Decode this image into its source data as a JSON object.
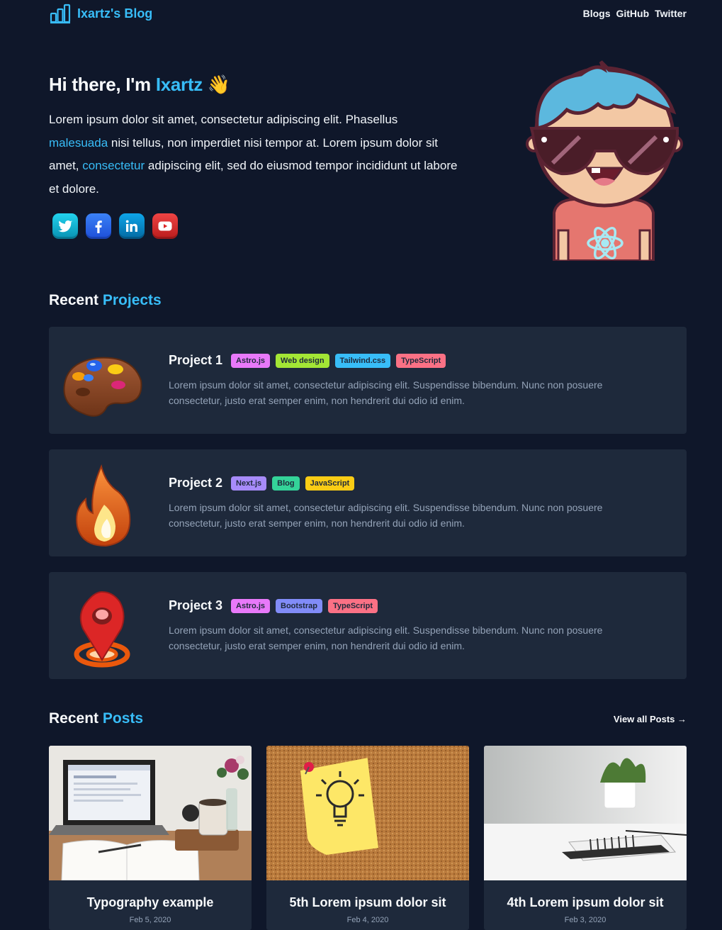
{
  "nav": {
    "brand": "Ixartz's Blog",
    "links": [
      "Blogs",
      "GitHub",
      "Twitter"
    ]
  },
  "hero": {
    "greeting": "Hi there, I'm ",
    "name": "Ixartz",
    "wave": "👋",
    "text_1": "Lorem ipsum dolor sit amet, consectetur adipiscing elit. Phasellus ",
    "link_1": "malesuada",
    "text_2": " nisi tellus, non imperdiet nisi tempor at. Lorem ipsum dolor sit amet, ",
    "link_2": "consectetur",
    "text_3": " adipiscing elit, sed do eiusmod tempor incididunt ut labore et dolore.",
    "socials": [
      "twitter-icon",
      "facebook-icon",
      "linkedin-icon",
      "youtube-icon"
    ]
  },
  "projects_section": {
    "title": "Recent ",
    "accent": "Projects"
  },
  "projects": [
    {
      "title": "Project 1",
      "icon": "palette-icon",
      "tags": [
        {
          "label": "Astro.js",
          "color": "#e879f9"
        },
        {
          "label": "Web design",
          "color": "#a3e635"
        },
        {
          "label": "Tailwind.css",
          "color": "#38bdf8"
        },
        {
          "label": "TypeScript",
          "color": "#fb7185"
        }
      ],
      "description": "Lorem ipsum dolor sit amet, consectetur adipiscing elit. Suspendisse bibendum. Nunc non posuere consectetur, justo erat semper enim, non hendrerit dui odio id enim."
    },
    {
      "title": "Project 2",
      "icon": "fire-icon",
      "tags": [
        {
          "label": "Next.js",
          "color": "#a78bfa"
        },
        {
          "label": "Blog",
          "color": "#34d399"
        },
        {
          "label": "JavaScript",
          "color": "#facc15"
        }
      ],
      "description": "Lorem ipsum dolor sit amet, consectetur adipiscing elit. Suspendisse bibendum. Nunc non posuere consectetur, justo erat semper enim, non hendrerit dui odio id enim."
    },
    {
      "title": "Project 3",
      "icon": "map-pin-icon",
      "tags": [
        {
          "label": "Astro.js",
          "color": "#e879f9"
        },
        {
          "label": "Bootstrap",
          "color": "#818cf8"
        },
        {
          "label": "TypeScript",
          "color": "#fb7185"
        }
      ],
      "description": "Lorem ipsum dolor sit amet, consectetur adipiscing elit. Suspendisse bibendum. Nunc non posuere consectetur, justo erat semper enim, non hendrerit dui odio id enim."
    }
  ],
  "posts_section": {
    "title": "Recent ",
    "accent": "Posts",
    "view_all": "View all Posts →"
  },
  "posts": [
    {
      "title": "Typography example",
      "date": "Feb 5, 2020"
    },
    {
      "title": "5th Lorem ipsum dolor sit",
      "date": "Feb 4, 2020"
    },
    {
      "title": "4th Lorem ipsum dolor sit",
      "date": "Feb 3, 2020"
    }
  ],
  "colors": {
    "background": "#0f172a",
    "card": "#1e293b",
    "accent": "#38bdf8",
    "muted_text": "#94a3b8"
  }
}
